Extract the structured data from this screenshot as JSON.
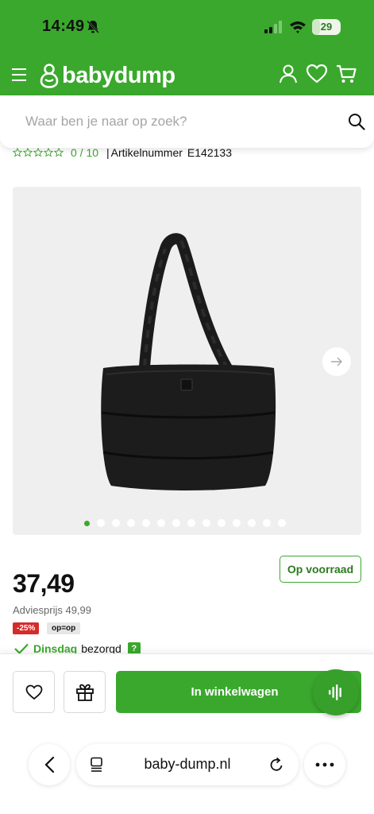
{
  "status_bar": {
    "time": "14:49",
    "battery": "29",
    "battery_fraction": 0.29
  },
  "header": {
    "logo_text": "babydump",
    "search_placeholder": "Waar ben je naar op zoek?"
  },
  "product": {
    "rating": "0 / 10",
    "article_separator": "|",
    "article_label": "Artikelnummer",
    "article_number": "E142133",
    "stock_label": "Op voorraad",
    "price": "37,49",
    "advice_price": "Adviesprijs 49,99",
    "discount_badge": "-25%",
    "opop_badge": "op=op",
    "delivery_day": "Dinsdag",
    "delivery_text": "bezorgd",
    "help_label": "?",
    "gallery_dot_count": 14,
    "gallery_active_index": 0
  },
  "actions": {
    "add_to_cart_label": "In winkelwagen"
  },
  "browser": {
    "url": "baby-dump.nl"
  },
  "colors": {
    "brand_green": "#3aa82d",
    "discount_red": "#d62b2b"
  },
  "icons": [
    "bell-muted-icon",
    "signal-icon",
    "wifi-icon",
    "menu-icon",
    "babydump-logo-icon",
    "user-icon",
    "heart-icon",
    "cart-icon",
    "search-icon",
    "star-icon",
    "chevron-right-icon",
    "check-icon",
    "help-icon",
    "gift-icon",
    "voice-icon",
    "chevron-left-icon",
    "tabs-icon",
    "reload-icon",
    "more-icon"
  ]
}
